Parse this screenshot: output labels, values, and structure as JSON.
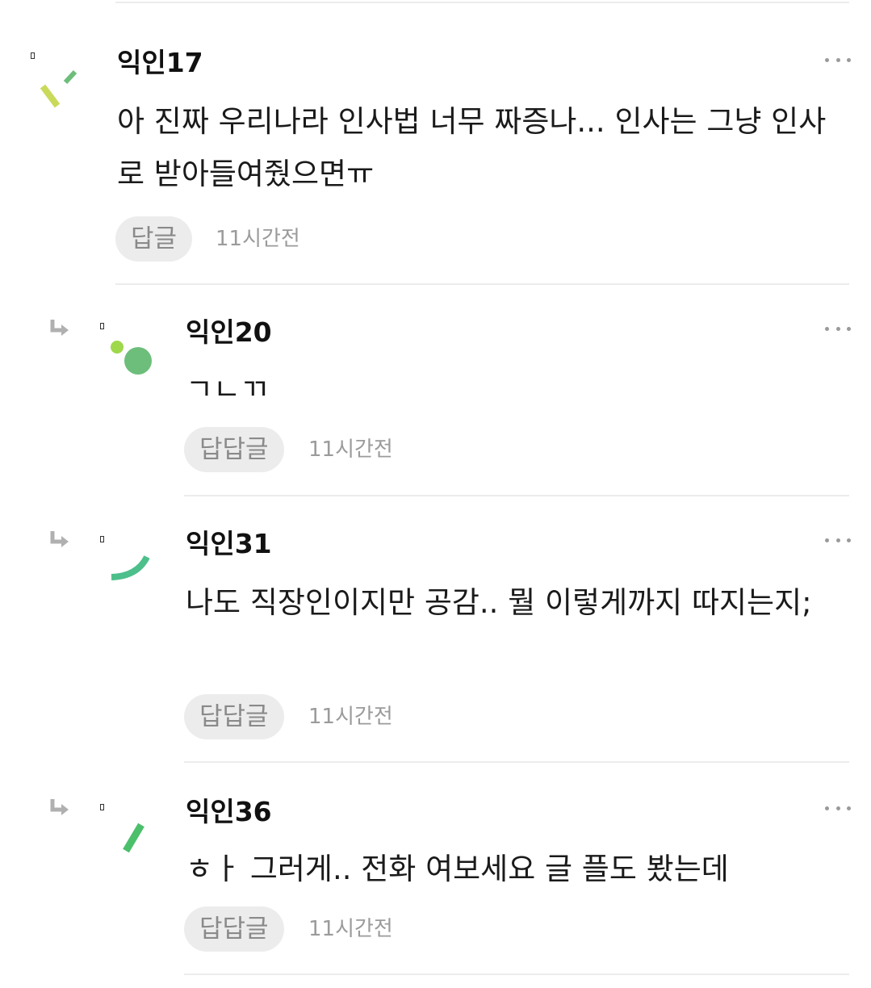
{
  "comments": [
    {
      "author": "익인17",
      "text": "아 진짜 우리나라 인사법 너무 짜증나... 인사는 그냥 인사로 받아들여줬으면ㅠ",
      "reply_label": "답글",
      "time": "11시간전",
      "is_reply": false
    },
    {
      "author": "익인20",
      "text": "ㄱㄴㄲ",
      "reply_label": "답답글",
      "time": "11시간전",
      "is_reply": true
    },
    {
      "author": "익인31",
      "text": "나도 직장인이지만 공감.. 뭘 이렇게까지 따지는지;",
      "reply_label": "답답글",
      "time": "11시간전",
      "is_reply": true
    },
    {
      "author": "익인36",
      "text": "ㅎㅏ 그러게.. 전화 여보세요 글 플도 봤는데",
      "reply_label": "답답글",
      "time": "11시간전",
      "is_reply": true
    }
  ],
  "icons": {
    "reply_arrow": "reply-arrow-icon",
    "more": "more-options-icon"
  },
  "colors": {
    "avatar_green": "#6dbe7b",
    "avatar_lime": "#9fd84a",
    "avatar_yellow": "#c9da5a",
    "avatar_dark_green": "#4cbf6b"
  }
}
